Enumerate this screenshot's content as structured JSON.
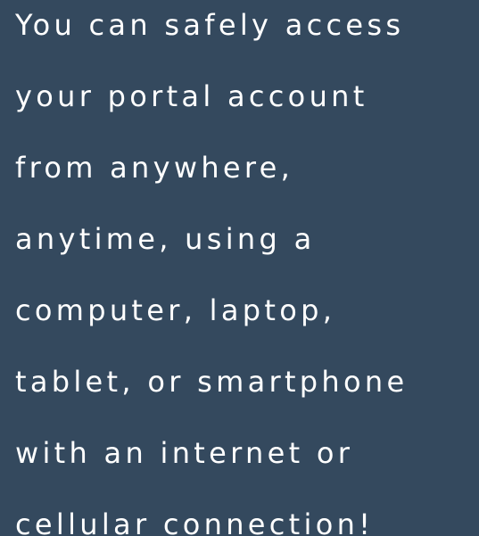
{
  "colors": {
    "background": "#34495e",
    "text": "#ffffff"
  },
  "message": {
    "lines": [
      "You can safely access",
      "your portal account",
      "from anywhere,",
      "anytime, using a",
      "computer, laptop,",
      "tablet, or smartphone",
      "with an internet or",
      "cellular connection!"
    ]
  }
}
